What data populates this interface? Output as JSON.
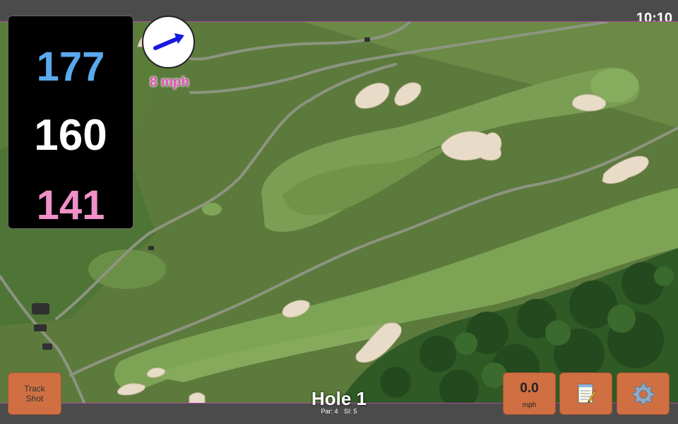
{
  "status": {
    "time": "10:10"
  },
  "distances": {
    "back": "177",
    "middle": "160",
    "front": "141"
  },
  "wind": {
    "speed": "8 mph",
    "direction": "north-east"
  },
  "hole": {
    "title": "Hole 1",
    "par": "Par: 4",
    "stroke_index": "SI: 5"
  },
  "buttons": {
    "track_shot": "Track Shot",
    "speed_value": "0.0",
    "speed_unit": "mph",
    "notes_icon": "notepad-icon",
    "settings_icon": "gear-icon"
  },
  "colors": {
    "back_distance": "#5aa9ee",
    "middle_distance": "#ffffff",
    "front_distance": "#f090c8",
    "button": "#cf6f42",
    "wind_text": "#e050b8",
    "accent_border": "#b04aa8"
  }
}
